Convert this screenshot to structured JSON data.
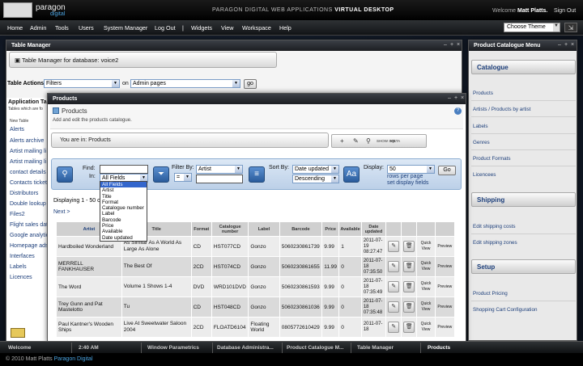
{
  "topbar": {
    "logo_line1": "paragon",
    "logo_line2": "digital",
    "app_title_prefix": "PARAGON DIGITAL WEB APPLICATIONS",
    "app_title_bold": "VIRTUAL DESKTOP",
    "welcome_prefix": "Welcome",
    "user": "Matt Platts.",
    "signout": "Sign Out"
  },
  "menu": [
    "Home",
    "Admin",
    "Tools",
    "Users",
    "System Manager",
    "Log Out",
    "|",
    "Widgets",
    "View",
    "Workspace",
    "Help"
  ],
  "theme": {
    "selected": "Choose Theme"
  },
  "table_manager": {
    "title": "Table Manager",
    "header": "Table Manager for database: voice2",
    "actions_label": "Table Actions:",
    "filters_value": "Filters",
    "on_label": "on",
    "pages_value": "Admin pages",
    "go": "go",
    "left_header": "Application Ta",
    "left_sub": "Tables which are fo",
    "left_new": "New Table",
    "left_items": [
      "Alerts",
      "Alerts archive",
      "Artist mailing li",
      "Artist mailing li",
      "contact details",
      "Contacts ticket",
      "Distributors",
      "Double lookup t",
      "Files2",
      "Flight sales dat",
      "Google analytic",
      "Homepage ads",
      "Interfaces",
      "Labels",
      "Licences"
    ]
  },
  "products": {
    "title": "Products",
    "name": "Products",
    "desc": "Add and edit the products catalogue.",
    "you_are_in": "You are in: Products",
    "toolbar": [
      "+",
      "✎",
      "⚲",
      "SHOW SQL",
      "META"
    ],
    "find_label": "Find:",
    "in_label": "In:",
    "in_value": "All Fields",
    "filter_by_label": "Filter By:",
    "filter_by_value": "Artist",
    "filter_op": "=",
    "sort_by_label": "Sort By:",
    "sort_value": "Date updated",
    "sort_dir": "Descending",
    "display_label": "Display:",
    "display_value": "50",
    "rows_per_page": "rows per page",
    "set_display": "set display fields",
    "go": "Go",
    "displaying": "Displaying 1 - 50 o",
    "next": "Next >",
    "dropdown_options": [
      "All Fields",
      "Artist",
      "Title",
      "Format",
      "Catalogue number",
      "Label",
      "Barcode",
      "Price",
      "Available",
      "Date updated"
    ],
    "columns": [
      "Artist",
      "Title",
      "Format",
      "Catalogue number",
      "Label",
      "Barcode",
      "Price",
      "Available",
      "Date updated"
    ],
    "rows": [
      {
        "artist": "Hardboiled Wonderland",
        "title": "As Similar As A World As Large As Alone",
        "format": "CD",
        "cat": "HST077CD",
        "label": "Gonzo",
        "barcode": "5060230861739",
        "price": "9.99",
        "avail": "1",
        "date": "2011-07-19 08:27:47"
      },
      {
        "artist": "MERRELL FANKHAUSER",
        "title": "The Best Of",
        "format": "2CD",
        "cat": "HST074CD",
        "label": "Gonzo",
        "barcode": "5060230861655",
        "price": "11.99",
        "avail": "0",
        "date": "2011-07-18 07:35:50"
      },
      {
        "artist": "The Word",
        "title": "Volume 1 Shows 1-4",
        "format": "DVD",
        "cat": "WRD101DVD",
        "label": "Gonzo",
        "barcode": "5060230861593",
        "price": "9.99",
        "avail": "0",
        "date": "2011-07-18 07:35:49"
      },
      {
        "artist": "Trey Gunn and Pat Mastelotto",
        "title": "Tu",
        "format": "CD",
        "cat": "HST048CD",
        "label": "Gonzo",
        "barcode": "5060230861036",
        "price": "9.99",
        "avail": "0",
        "date": "2011-07-18 07:35:48"
      },
      {
        "artist": "Paul Kantner's Wooden Ships",
        "title": "Live At Sweetwater Saloon 2004",
        "format": "2CD",
        "cat": "FLOATD6104",
        "label": "Floating World",
        "barcode": "0805772610429",
        "price": "9.99",
        "avail": "0",
        "date": "2011-07-18"
      }
    ],
    "quick_view": "Quick View",
    "preview": "Preview"
  },
  "catalogue_menu": {
    "title": "Product Catalogue Menu",
    "sections": [
      {
        "name": "Catalogue",
        "items": [
          "Products",
          "Artists / Products by artist",
          "Labels",
          "Genres",
          "Product Formats",
          "Licencees"
        ]
      },
      {
        "name": "Shipping",
        "items": [
          "Edit shipping costs",
          "Edit shipping zones"
        ]
      },
      {
        "name": "Setup",
        "items": [
          "Product Pricing",
          "Shopping Cart Configuration"
        ]
      }
    ]
  },
  "taskbar": [
    "Welcome",
    "2:40 AM",
    "Window Parametrics",
    "Database Administra...",
    "Product Catalogue M...",
    "Table Manager",
    "Products"
  ],
  "footer": {
    "copy": "© 2010 Matt Platts",
    "brand": "Paragon Digital"
  },
  "colors": {
    "link": "#1c3e7a",
    "accent": "#3366cc",
    "title_bar": "#1c1e22"
  }
}
